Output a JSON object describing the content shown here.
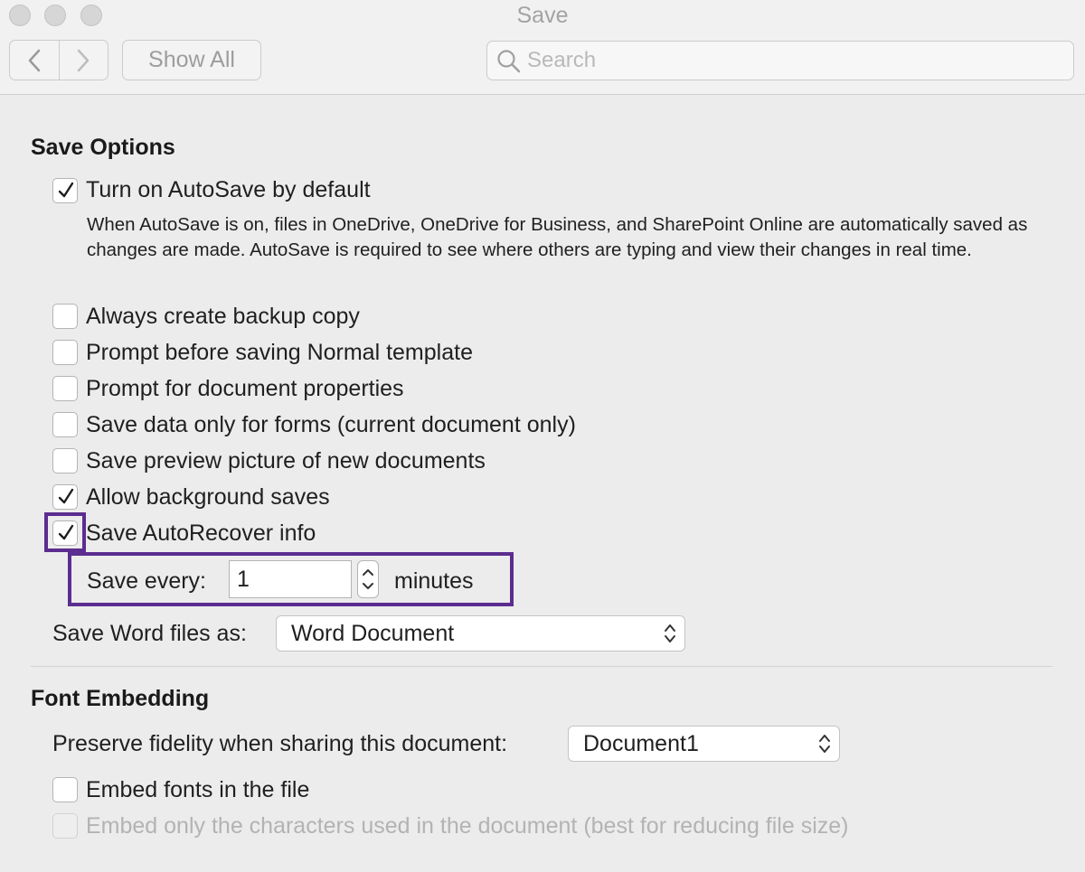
{
  "window": {
    "title": "Save"
  },
  "toolbar": {
    "show_all_label": "Show All",
    "search_placeholder": "Search"
  },
  "save_options": {
    "heading": "Save Options",
    "autosave": {
      "label": "Turn on AutoSave by default",
      "checked": true,
      "description": "When AutoSave is on, files in OneDrive, OneDrive for Business, and SharePoint Online are automatically saved as changes are made. AutoSave is required to see where others are typing and view their changes in real time."
    },
    "checkboxes": [
      {
        "label": "Always create backup copy",
        "checked": false
      },
      {
        "label": "Prompt before saving Normal template",
        "checked": false
      },
      {
        "label": "Prompt for document properties",
        "checked": false
      },
      {
        "label": "Save data only for forms (current document only)",
        "checked": false
      },
      {
        "label": "Save preview picture of new documents",
        "checked": false
      },
      {
        "label": "Allow background saves",
        "checked": true
      },
      {
        "label": "Save AutoRecover info",
        "checked": true
      }
    ],
    "save_every": {
      "label": "Save every:",
      "value": "1",
      "unit": "minutes"
    },
    "save_word_files": {
      "label": "Save Word files as:",
      "value": "Word Document"
    }
  },
  "font_embedding": {
    "heading": "Font Embedding",
    "preserve": {
      "label": "Preserve fidelity when sharing this document:",
      "value": "Document1"
    },
    "embed_fonts": {
      "label": "Embed fonts in the file",
      "checked": false
    },
    "embed_only": {
      "label": "Embed only the characters used in the document (best for reducing file size)",
      "checked": false,
      "disabled": true
    }
  },
  "colors": {
    "highlight": "#5b2d90"
  }
}
